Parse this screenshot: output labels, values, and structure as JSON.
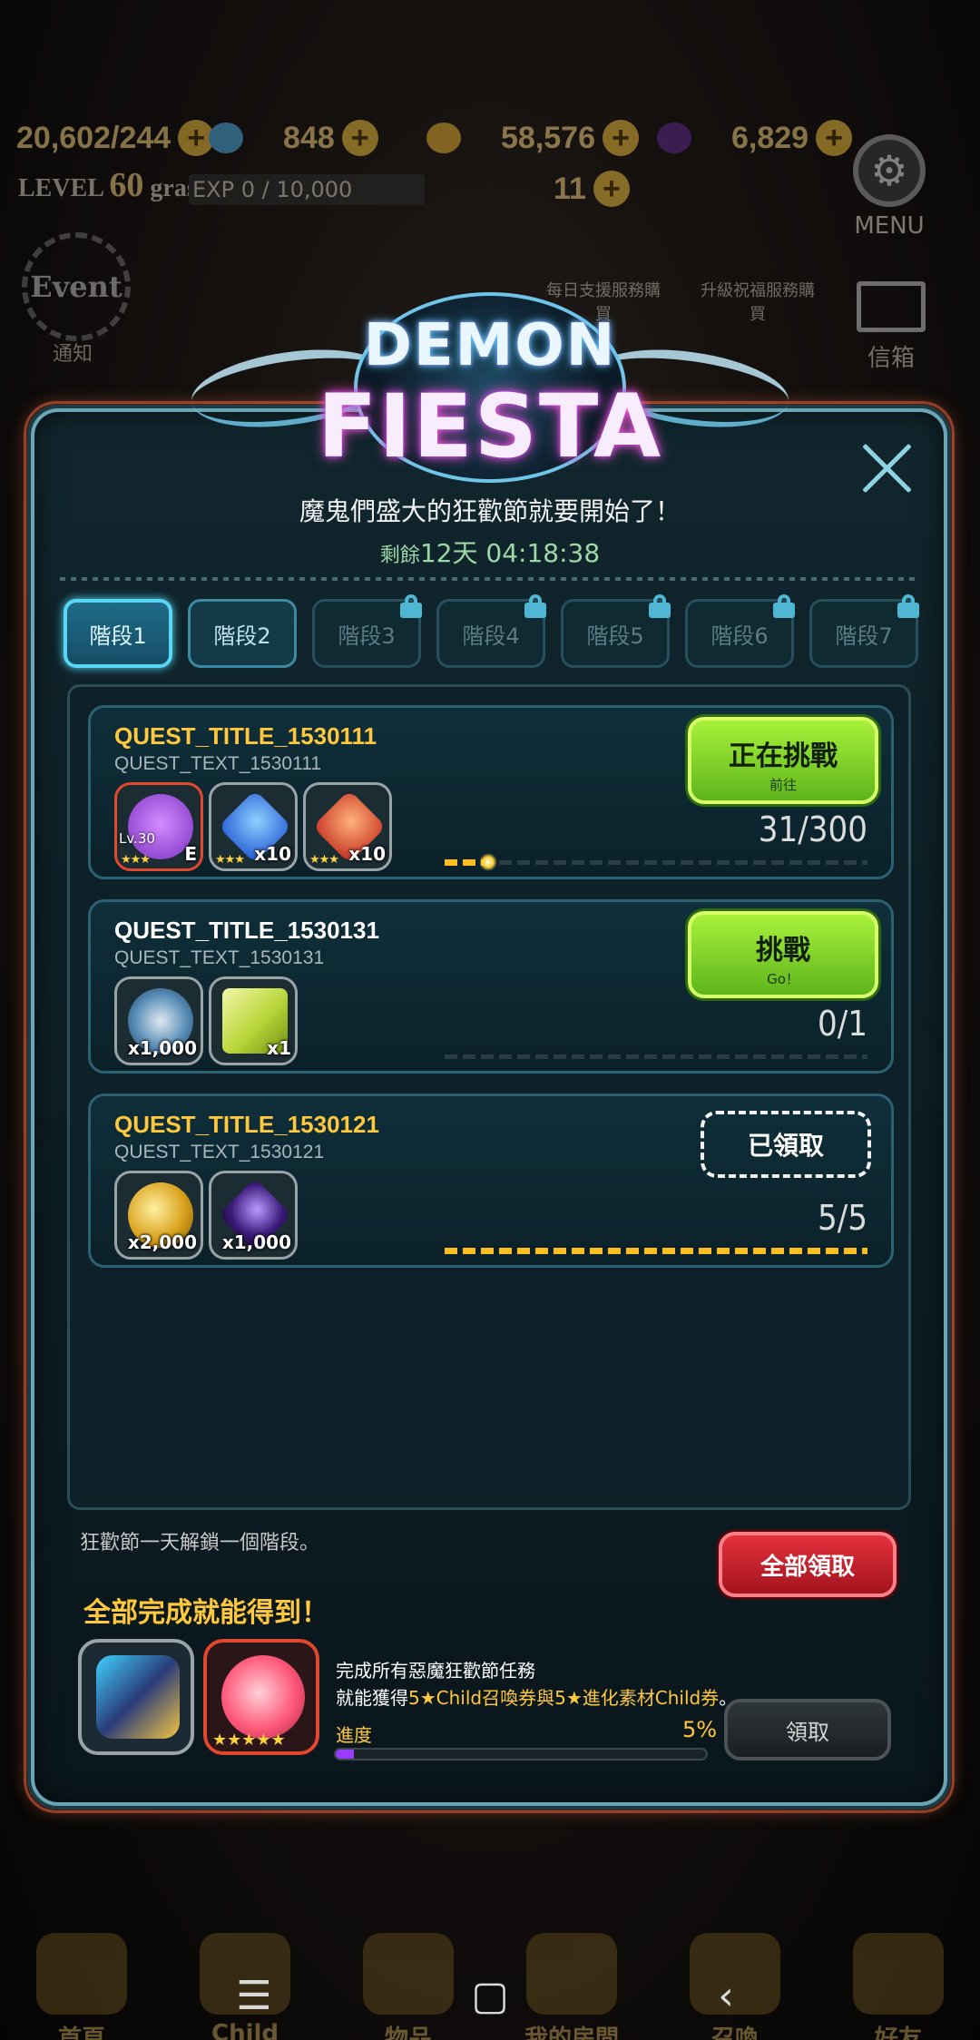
{
  "hud": {
    "stamina": "20,602/244",
    "gold_small": "848",
    "coins": "58,576",
    "gems": "6,829",
    "level_label": "LEVEL",
    "level_value": "60",
    "player_name": "grass",
    "exp": "EXP 0 / 10,000",
    "tickets": "11",
    "menu_label": "MENU",
    "mail_label": "信箱",
    "event_label": "Event",
    "notice_label": "通知",
    "daily_label": "每日支援服務購買",
    "upgrade_label": "升級祝福服務購買"
  },
  "event": {
    "logo_line1": "DEMON",
    "logo_line2": "FIESTA",
    "subtitle": "魔鬼們盛大的狂歡節就要開始了！",
    "timer_prefix": "剩餘",
    "timer_value": "12天 04:18:38"
  },
  "tabs": [
    {
      "label": "階段1",
      "state": "active"
    },
    {
      "label": "階段2",
      "state": "open"
    },
    {
      "label": "階段3",
      "state": "locked"
    },
    {
      "label": "階段4",
      "state": "locked"
    },
    {
      "label": "階段5",
      "state": "locked"
    },
    {
      "label": "階段6",
      "state": "locked"
    },
    {
      "label": "階段7",
      "state": "locked"
    }
  ],
  "quests": [
    {
      "title": "QUEST_TITLE_1530111",
      "text": "QUEST_TEXT_1530111",
      "progress": "31/300",
      "progress_fraction": 0.103,
      "button_main": "正在挑戰",
      "button_sub": "前往",
      "rewards": [
        {
          "icon": "purple-monster-icon",
          "qty": "E",
          "level": "Lv.30",
          "stars": "★★★"
        },
        {
          "icon": "blue-gem-icon",
          "qty": "x10",
          "stars": "★★★"
        },
        {
          "icon": "red-gem-icon",
          "qty": "x10",
          "stars": "★★★"
        }
      ]
    },
    {
      "title": "QUEST_TITLE_1530131",
      "text": "QUEST_TEXT_1530131",
      "progress": "0/1",
      "progress_fraction": 0,
      "button_main": "挑戰",
      "button_sub": "Go！",
      "rewards": [
        {
          "icon": "stopwatch-icon",
          "qty": "x1,000"
        },
        {
          "icon": "ticket-icon",
          "qty": "x1"
        }
      ]
    },
    {
      "title": "QUEST_TITLE_1530121",
      "text": "QUEST_TEXT_1530121",
      "progress": "5/5",
      "progress_fraction": 1,
      "claimed_label": "已領取",
      "rewards": [
        {
          "icon": "gold-coins-icon",
          "qty": "x2,000"
        },
        {
          "icon": "dark-crystal-icon",
          "qty": "x1,000"
        }
      ]
    }
  ],
  "footer": {
    "unlock_note": "狂歡節一天解鎖一個階段。",
    "claim_all": "全部領取",
    "bonus_title": "全部完成就能得到！",
    "bonus_line1": "完成所有惡魔狂歡節任務",
    "bonus_line2_prefix": "就能獲得",
    "bonus_line2_highlight": "5★Child召喚券與5★進化素材Child券",
    "bonus_line2_suffix": "。",
    "progress_label": "進度",
    "progress_pct": "5%",
    "progress_fraction": 0.05,
    "claim_label": "領取",
    "bonus_stars": "★★★★★"
  },
  "bottom_nav": [
    {
      "label": "首頁"
    },
    {
      "label": "Child"
    },
    {
      "label": "物品"
    },
    {
      "label": "我的房間"
    },
    {
      "label": "召喚"
    },
    {
      "label": "好友"
    }
  ],
  "colors": {
    "accent_gold": "#ffc83d",
    "active_tab": "#57d7f5",
    "green_button": "#6fc61f",
    "red_button": "#d0222d",
    "progress_purple": "#9a3cff"
  }
}
